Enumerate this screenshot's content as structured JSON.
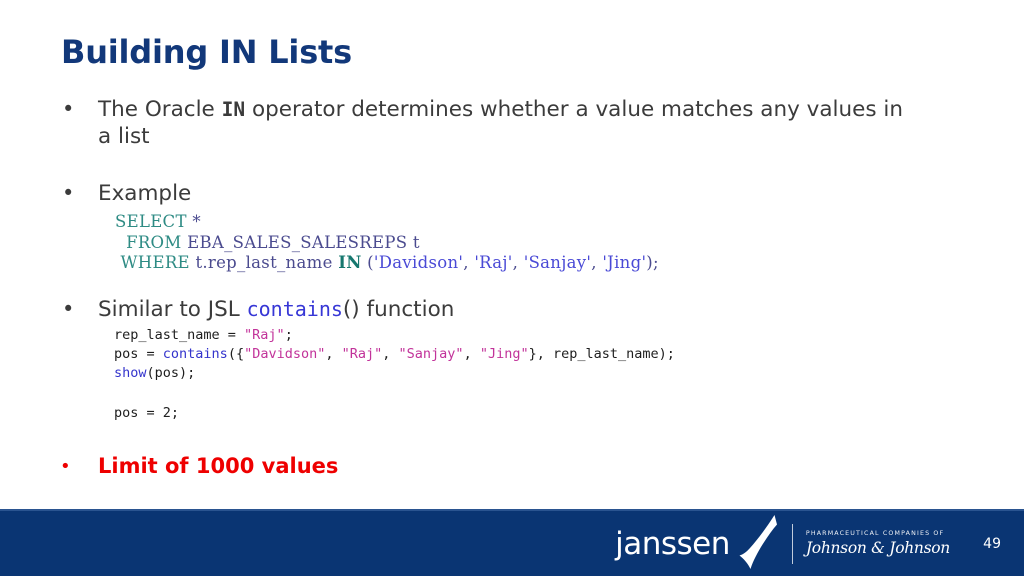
{
  "slide": {
    "title": "Building IN Lists",
    "title_color": "#12387a",
    "background": "#ffffff"
  },
  "bullets": [
    {
      "id": "in-operator",
      "marker": "•",
      "text_before": "The Oracle ",
      "keyword": "IN",
      "text_after": " operator determines whether a value matches any values in a list",
      "style": "plain"
    },
    {
      "id": "example",
      "marker": "•",
      "text": "Example",
      "style": "plain"
    },
    {
      "id": "similar-jsl",
      "marker": "•",
      "text_before": "Similar to JSL ",
      "keyword": "contains",
      "text_after": "() function",
      "style": "plain"
    },
    {
      "id": "limit",
      "marker": "•",
      "text": "Limit of 1000 values",
      "style": "red-bold",
      "color": "#ee0000"
    }
  ],
  "sql_code": {
    "lines": [
      [
        {
          "t": "SELECT ",
          "c": "kw"
        },
        {
          "t": "*",
          "c": "pun"
        }
      ],
      [
        {
          "t": "  FROM ",
          "c": "kw"
        },
        {
          "t": "EBA_SALES_SALESREPS t",
          "c": "id"
        }
      ],
      [
        {
          "t": " WHERE ",
          "c": "kw"
        },
        {
          "t": "t.rep_last_name ",
          "c": "id"
        },
        {
          "t": "IN",
          "c": "kw-b"
        },
        {
          "t": " (",
          "c": "pun"
        },
        {
          "t": "'Davidson'",
          "c": "str"
        },
        {
          "t": ", ",
          "c": "pun"
        },
        {
          "t": "'Raj'",
          "c": "str"
        },
        {
          "t": ", ",
          "c": "pun"
        },
        {
          "t": "'Sanjay'",
          "c": "str"
        },
        {
          "t": ", ",
          "c": "pun"
        },
        {
          "t": "'Jing'",
          "c": "str"
        },
        {
          "t": ");",
          "c": "pun"
        }
      ]
    ],
    "colors": {
      "keyword": "#2e8b84",
      "identifier": "#4b4b8f",
      "string": "#4a4ad6"
    }
  },
  "jsl_code": {
    "lines": [
      [
        {
          "t": "rep_last_name = ",
          "c": "plain"
        },
        {
          "t": "\"Raj\"",
          "c": "str"
        },
        {
          "t": ";",
          "c": "plain"
        }
      ],
      [
        {
          "t": "pos = ",
          "c": "plain"
        },
        {
          "t": "contains",
          "c": "fn"
        },
        {
          "t": "({",
          "c": "plain"
        },
        {
          "t": "\"Davidson\"",
          "c": "str"
        },
        {
          "t": ", ",
          "c": "plain"
        },
        {
          "t": "\"Raj\"",
          "c": "str"
        },
        {
          "t": ", ",
          "c": "plain"
        },
        {
          "t": "\"Sanjay\"",
          "c": "str"
        },
        {
          "t": ", ",
          "c": "plain"
        },
        {
          "t": "\"Jing\"",
          "c": "str"
        },
        {
          "t": "}, rep_last_name);",
          "c": "plain"
        }
      ],
      [
        {
          "t": "show",
          "c": "fn"
        },
        {
          "t": "(pos);",
          "c": "plain"
        }
      ]
    ],
    "result_lines": [
      [
        {
          "t": "pos = 2;",
          "c": "plain"
        }
      ]
    ],
    "colors": {
      "function": "#3434cc",
      "string": "#c2339a"
    }
  },
  "footer": {
    "background": "#0a3573",
    "brand": "janssen",
    "jnj_tagline": "PHARMACEUTICAL COMPANIES OF",
    "jnj_wordmark": "Johnson & Johnson",
    "page_number": "49"
  }
}
